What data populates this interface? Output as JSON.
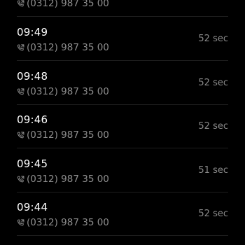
{
  "calls": [
    {
      "time": "",
      "number": "(0312) 987 35 00",
      "duration": "",
      "icon": "phone-outgoing-icon"
    },
    {
      "time": "09:49",
      "number": "(0312) 987 35 00",
      "duration": "52 sec",
      "icon": "phone-outgoing-icon"
    },
    {
      "time": "09:48",
      "number": "(0312) 987 35 00",
      "duration": "52 sec",
      "icon": "phone-outgoing-icon"
    },
    {
      "time": "09:46",
      "number": "(0312) 987 35 00",
      "duration": "52 sec",
      "icon": "phone-outgoing-icon"
    },
    {
      "time": "09:45",
      "number": "(0312) 987 35 00",
      "duration": "51 sec",
      "icon": "phone-outgoing-icon"
    },
    {
      "time": "09:44",
      "number": "(0312) 987 35 00",
      "duration": "52 sec",
      "icon": "phone-outgoing-icon"
    }
  ],
  "colors": {
    "background": "#000000",
    "time_text": "#ffffff",
    "secondary_text": "#8e8e8e",
    "divider": "#1e1e1e"
  }
}
